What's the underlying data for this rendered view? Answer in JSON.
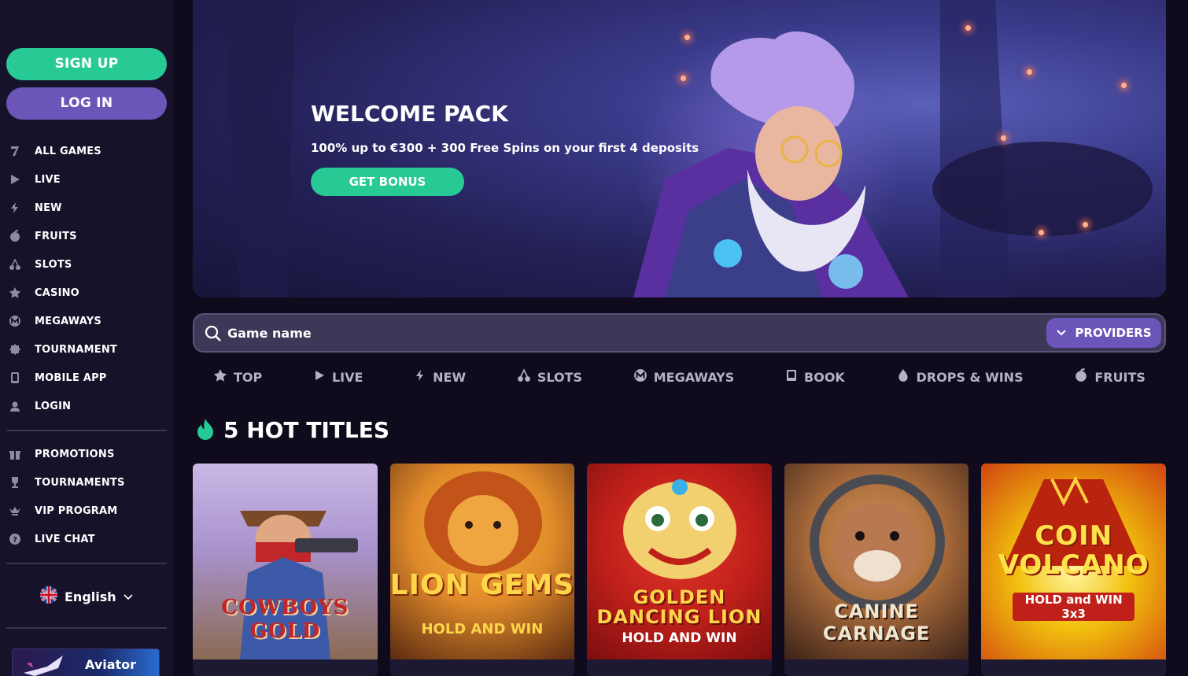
{
  "sidebar": {
    "signup_label": "SIGN UP",
    "login_label": "LOG IN",
    "nav_items": [
      {
        "label": "ALL GAMES",
        "icon": "seven-icon"
      },
      {
        "label": "LIVE",
        "icon": "play-icon"
      },
      {
        "label": "NEW",
        "icon": "lightning-icon"
      },
      {
        "label": "FRUITS",
        "icon": "fruit-icon"
      },
      {
        "label": "SLOTS",
        "icon": "cherries-icon"
      },
      {
        "label": "CASINO",
        "icon": "star-icon"
      },
      {
        "label": "MEGAWAYS",
        "icon": "megaways-icon"
      },
      {
        "label": "TOURNAMENT",
        "icon": "badge-icon"
      },
      {
        "label": "MOBILE APP",
        "icon": "phone-icon"
      },
      {
        "label": "LOGIN",
        "icon": "login-icon"
      }
    ],
    "secondary_items": [
      {
        "label": "PROMOTIONS",
        "icon": "gift-icon"
      },
      {
        "label": "TOURNAMENTS",
        "icon": "trophy-icon"
      },
      {
        "label": "VIP PROGRAM",
        "icon": "vip-icon"
      },
      {
        "label": "LIVE CHAT",
        "icon": "help-icon"
      }
    ],
    "language": "English",
    "promo_tile_label": "Aviator"
  },
  "hero": {
    "title": "WELCOME PACK",
    "subtitle": "100% up to €300 + 300 Free Spins on your first 4 deposits",
    "button_label": "GET BONUS"
  },
  "search": {
    "placeholder": "Game name",
    "providers_label": "PROVIDERS"
  },
  "tabs": [
    {
      "label": "TOP",
      "icon": "star-icon"
    },
    {
      "label": "LIVE",
      "icon": "play-icon"
    },
    {
      "label": "NEW",
      "icon": "lightning-icon"
    },
    {
      "label": "SLOTS",
      "icon": "cherries-icon"
    },
    {
      "label": "MEGAWAYS",
      "icon": "megaways-icon"
    },
    {
      "label": "BOOK",
      "icon": "book-icon"
    },
    {
      "label": "DROPS & WINS",
      "icon": "drops-icon"
    },
    {
      "label": "FRUITS",
      "icon": "fruit-icon"
    }
  ],
  "hot_titles": {
    "heading": "5 HOT TITLES",
    "games": [
      {
        "art_title": "COWBOYS GOLD",
        "art_sub": "",
        "colors": [
          "#b9a9d6",
          "#8a6a52"
        ]
      },
      {
        "art_title": "LION GEMS",
        "art_sub": "HOLD AND WIN",
        "colors": [
          "#e08a2a",
          "#5a2a10"
        ]
      },
      {
        "art_title": "GOLDEN DANCING LION",
        "art_sub": "HOLD AND WIN",
        "colors": [
          "#c0201a",
          "#7a0e0e"
        ]
      },
      {
        "art_title": "CANINE CARNAGE",
        "art_sub": "",
        "colors": [
          "#a86a3a",
          "#3a2218"
        ]
      },
      {
        "art_title": "COIN VOLCANO",
        "art_sub": "HOLD and WIN 3x3",
        "colors": [
          "#f2c10e",
          "#d0440f"
        ]
      }
    ]
  },
  "colors": {
    "accent_green": "#27c994",
    "accent_purple": "#6b55b8",
    "sidebar_bg": "#16122a",
    "page_bg": "#0f0b1d"
  }
}
